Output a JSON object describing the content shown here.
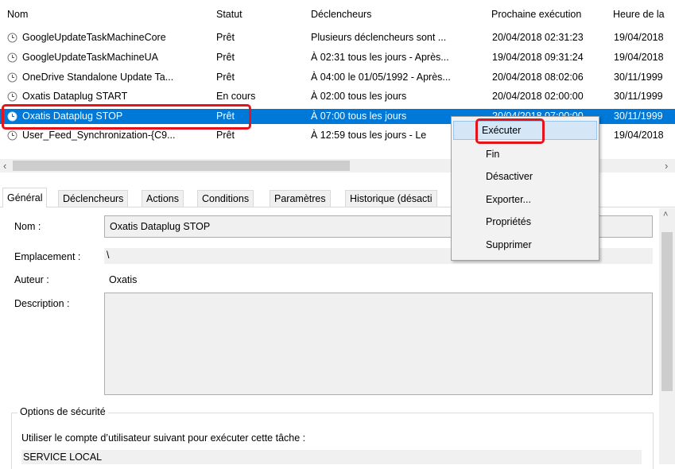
{
  "columns": [
    "Nom",
    "Statut",
    "Déclencheurs",
    "Prochaine exécution",
    "Heure de la"
  ],
  "tasks": [
    {
      "name": "GoogleUpdateTaskMachineCore",
      "status": "Prêt",
      "trigger": "Plusieurs déclencheurs sont ...",
      "next": "20/04/2018 02:31:23",
      "last": "19/04/2018"
    },
    {
      "name": "GoogleUpdateTaskMachineUA",
      "status": "Prêt",
      "trigger": "À 02:31 tous les jours - Après...",
      "next": "19/04/2018 09:31:24",
      "last": "19/04/2018"
    },
    {
      "name": "OneDrive Standalone Update Ta...",
      "status": "Prêt",
      "trigger": "À 04:00 le 01/05/1992 - Après...",
      "next": "20/04/2018 08:02:06",
      "last": "30/11/1999"
    },
    {
      "name": "Oxatis Dataplug START",
      "status": "En cours",
      "trigger": "À 02:00 tous les jours",
      "next": "20/04/2018 02:00:00",
      "last": "30/11/1999"
    },
    {
      "name": "Oxatis Dataplug STOP",
      "status": "Prêt",
      "trigger": "À 07:00 tous les jours",
      "next": "20/04/2018 07:00:00",
      "last": "30/11/1999"
    },
    {
      "name": "User_Feed_Synchronization-{C9...",
      "status": "Prêt",
      "trigger": "À 12:59 tous les jours - Le",
      "next": "",
      "last": "19/04/2018"
    }
  ],
  "tabs": [
    "Général",
    "Déclencheurs",
    "Actions",
    "Conditions",
    "Paramètres",
    "Historique (désacti"
  ],
  "details": {
    "name_label": "Nom :",
    "name_value": "Oxatis Dataplug STOP",
    "location_label": "Emplacement :",
    "location_value": "\\",
    "author_label": "Auteur :",
    "author_value": "Oxatis",
    "description_label": "Description :",
    "description_value": "",
    "security_title": "Options de sécurité",
    "security_text": "Utiliser le compte d’utilisateur suivant pour exécuter cette tâche :",
    "account": "SERVICE LOCAL"
  },
  "context_menu": [
    "Exécuter",
    "Fin",
    "Désactiver",
    "Exporter...",
    "Propriétés",
    "Supprimer"
  ],
  "highlight_color": "#e5141b",
  "selection_color": "#0078d7"
}
